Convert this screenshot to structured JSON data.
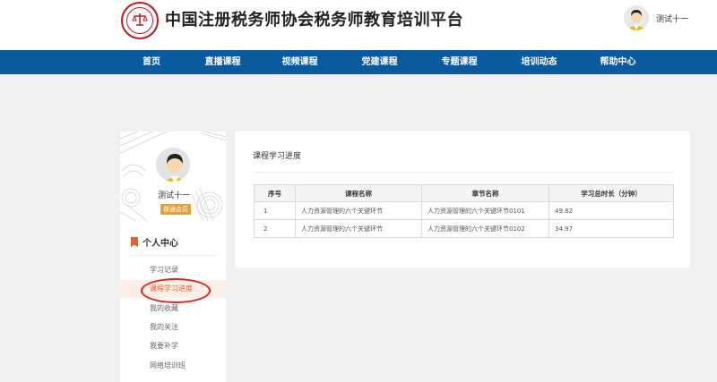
{
  "header": {
    "site_title": "中国注册税务师协会税务师教育培训平台",
    "user_name": "测试十一"
  },
  "nav": {
    "items": [
      "首页",
      "直播课程",
      "视频课程",
      "党建课程",
      "专题课程",
      "培训动态",
      "帮助中心"
    ]
  },
  "sidebar": {
    "user_name": "测试十一",
    "member_badge": "普通会员",
    "section_title": "个人中心",
    "menu": [
      "学习记录",
      "课程学习进度",
      "我的收藏",
      "我的关注",
      "我要补学",
      "网络培训班"
    ],
    "active_index": 1
  },
  "content": {
    "title": "课程学习进度",
    "table": {
      "headers": [
        "序号",
        "课程名称",
        "章节名称",
        "学习总时长（分钟）"
      ],
      "rows": [
        [
          "1",
          "人力资源管理的六个关键环节",
          "人力资源管理的六个关键环节0101",
          "49.82"
        ],
        [
          "2",
          "人力资源管理的六个关键环节",
          "人力资源管理的六个关键环节0102",
          "34.97"
        ]
      ]
    }
  },
  "colors": {
    "nav_bg": "#0a5aa0",
    "accent_orange": "#e8612c",
    "brand_red": "#c8161d",
    "badge": "#e2a23b",
    "annotation_circle": "#e02020"
  }
}
